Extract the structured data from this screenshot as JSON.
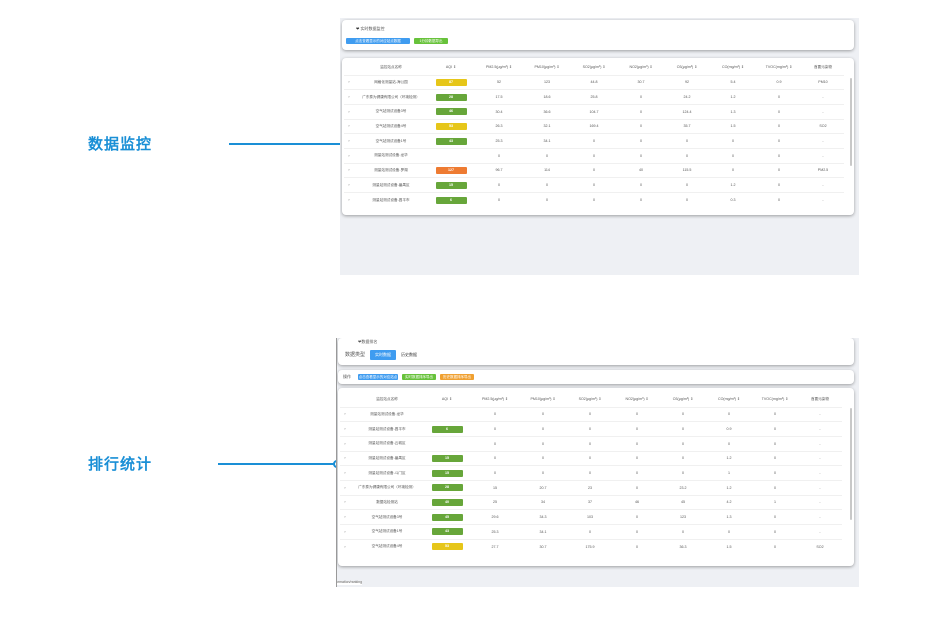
{
  "callouts": {
    "top": "数据监控",
    "bottom": "排行统计"
  },
  "monitor": {
    "section_title": "实时数据监控",
    "btn_view": "点击查看显示的对应站点数据",
    "btn_export": "1分钟数据导出",
    "headers": [
      "监控站点名称",
      "AQI ⇕",
      "PM2.5(μg/m³) ⇕",
      "PM10(μg/m³) ⇕",
      "SO2(μg/m³) ⇕",
      "NO2(μg/m³) ⇕",
      "O3(μg/m³) ⇕",
      "CO(mg/m³) ⇕",
      "TVOC(mg/m³) ⇕",
      "首要污染物"
    ],
    "rows": [
      {
        "name": "网格化测量站-海公园",
        "aqi": "87",
        "aqi_color": "#e6c619",
        "pm25": "52",
        "pm10": "123",
        "so2": "44.8",
        "no2": "30.7",
        "o3": "92",
        "co": "5.4",
        "tvoc": "0.9",
        "primary": "PM10"
      },
      {
        "name": "广东泰为健康有限公司（环境检测）",
        "aqi": "28",
        "aqi_color": "#67a63a",
        "pm25": "17.5",
        "pm10": "18.6",
        "so2": "25.8",
        "no2": "0",
        "o3": "24.2",
        "co": "1.2",
        "tvoc": "0",
        "primary": "-"
      },
      {
        "name": "空气站测试设备3号",
        "aqi": "46",
        "aqi_color": "#67a63a",
        "pm25": "30.4",
        "pm10": "36.6",
        "so2": "104.7",
        "no2": "0",
        "o3": "124.4",
        "co": "1.3",
        "tvoc": "0",
        "primary": "-"
      },
      {
        "name": "空气站测试设备4号",
        "aqi": "53",
        "aqi_color": "#e6c619",
        "pm25": "26.3",
        "pm10": "32.1",
        "so2": "169.4",
        "no2": "0",
        "o3": "35.7",
        "co": "1.5",
        "tvoc": "0",
        "primary": "SO2"
      },
      {
        "name": "空气站测试设备1号",
        "aqi": "43",
        "aqi_color": "#67a63a",
        "pm25": "25.3",
        "pm10": "34.1",
        "so2": "0",
        "no2": "0",
        "o3": "0",
        "co": "0",
        "tvoc": "0",
        "primary": "-"
      },
      {
        "name": "测量站测试设备-龙华",
        "aqi": "",
        "aqi_color": "",
        "pm25": "0",
        "pm10": "0",
        "so2": "0",
        "no2": "0",
        "o3": "0",
        "co": "0",
        "tvoc": "0",
        "primary": "-"
      },
      {
        "name": "测量站测试设备-罗湖",
        "aqi": "127",
        "aqi_color": "#ee7b32",
        "pm25": "96.7",
        "pm10": "114",
        "so2": "0",
        "no2": "40",
        "o3": "115.5",
        "co": "0",
        "tvoc": "0",
        "primary": "PM2.5"
      },
      {
        "name": "测量站测试设备-番禺区",
        "aqi": "15",
        "aqi_color": "#67a63a",
        "pm25": "0",
        "pm10": "0",
        "so2": "0",
        "no2": "0",
        "o3": "0",
        "co": "1.2",
        "tvoc": "0",
        "primary": "-"
      },
      {
        "name": "测量站测试设备-昌平市",
        "aqi": "6",
        "aqi_color": "#67a63a",
        "pm25": "0",
        "pm10": "0",
        "so2": "0",
        "no2": "0",
        "o3": "0",
        "co": "0.3",
        "tvoc": "0",
        "primary": "-"
      }
    ]
  },
  "ranking": {
    "section_title": "数据排名",
    "type_label": "数据类型",
    "tabs": [
      "实时数据",
      "历史数据"
    ],
    "ops_label": "操作",
    "btn_view": "点击查看显示的对应站点",
    "btn_realtime": "实时数据排序导出",
    "btn_history": "历史数据排序导出",
    "headers": [
      "监控站点名称",
      "AQI ⇕",
      "PM2.5(μg/m³) ⇕",
      "PM10(μg/m³) ⇕",
      "SO2(μg/m³) ⇕",
      "NO2(μg/m³) ⇕",
      "O3(μg/m³) ⇕",
      "CO(mg/m³) ⇕",
      "TVOC(mg/m³) ⇕",
      "首要污染物"
    ],
    "rows": [
      {
        "name": "测量站测试设备-龙华",
        "aqi": "",
        "aqi_color": "",
        "pm25": "0",
        "pm10": "0",
        "so2": "0",
        "no2": "0",
        "o3": "0",
        "co": "0",
        "tvoc": "0",
        "primary": "-"
      },
      {
        "name": "测量站测试设备-昌平市",
        "aqi": "6",
        "aqi_color": "#67a63a",
        "pm25": "0",
        "pm10": "0",
        "so2": "0",
        "no2": "0",
        "o3": "0",
        "co": "0.9",
        "tvoc": "0",
        "primary": "-"
      },
      {
        "name": "测量站测试设备-云城区",
        "aqi": "",
        "aqi_color": "",
        "pm25": "0",
        "pm10": "0",
        "so2": "0",
        "no2": "0",
        "o3": "0",
        "co": "0",
        "tvoc": "0",
        "primary": "-"
      },
      {
        "name": "测量站测试设备-番禺区",
        "aqi": "15",
        "aqi_color": "#67a63a",
        "pm25": "0",
        "pm10": "0",
        "so2": "0",
        "no2": "0",
        "o3": "0",
        "co": "1.2",
        "tvoc": "0",
        "primary": "-"
      },
      {
        "name": "测量站测试设备-斗门区",
        "aqi": "15",
        "aqi_color": "#67a63a",
        "pm25": "0",
        "pm10": "0",
        "so2": "0",
        "no2": "0",
        "o3": "0",
        "co": "1",
        "tvoc": "0",
        "primary": "-"
      },
      {
        "name": "广东泰为健康有限公司（环境检测）",
        "aqi": "28",
        "aqi_color": "#67a63a",
        "pm25": "15",
        "pm10": "20.7",
        "so2": "23",
        "no2": "0",
        "o3": "23.2",
        "co": "1.2",
        "tvoc": "0",
        "primary": "-"
      },
      {
        "name": "数据站检测站",
        "aqi": "40",
        "aqi_color": "#67a63a",
        "pm25": "25",
        "pm10": "34",
        "so2": "37",
        "no2": "46",
        "o3": "45",
        "co": "4.2",
        "tvoc": "1",
        "primary": "-"
      },
      {
        "name": "空气站测试设备3号",
        "aqi": "45",
        "aqi_color": "#67a63a",
        "pm25": "29.6",
        "pm10": "34.3",
        "so2": "103",
        "no2": "0",
        "o3": "123",
        "co": "1.3",
        "tvoc": "0",
        "primary": "-"
      },
      {
        "name": "空气站测试设备1号",
        "aqi": "43",
        "aqi_color": "#67a63a",
        "pm25": "25.3",
        "pm10": "34.1",
        "so2": "0",
        "no2": "0",
        "o3": "0",
        "co": "0",
        "tvoc": "0",
        "primary": "-"
      },
      {
        "name": "空气站测试设备4号",
        "aqi": "53",
        "aqi_color": "#e6c619",
        "pm25": "27.7",
        "pm10": "30.7",
        "so2": "175.9",
        "no2": "0",
        "o3": "36.3",
        "co": "1.5",
        "tvoc": "0",
        "primary": "SO2"
      }
    ],
    "footer_text": "ormation/ranking"
  }
}
